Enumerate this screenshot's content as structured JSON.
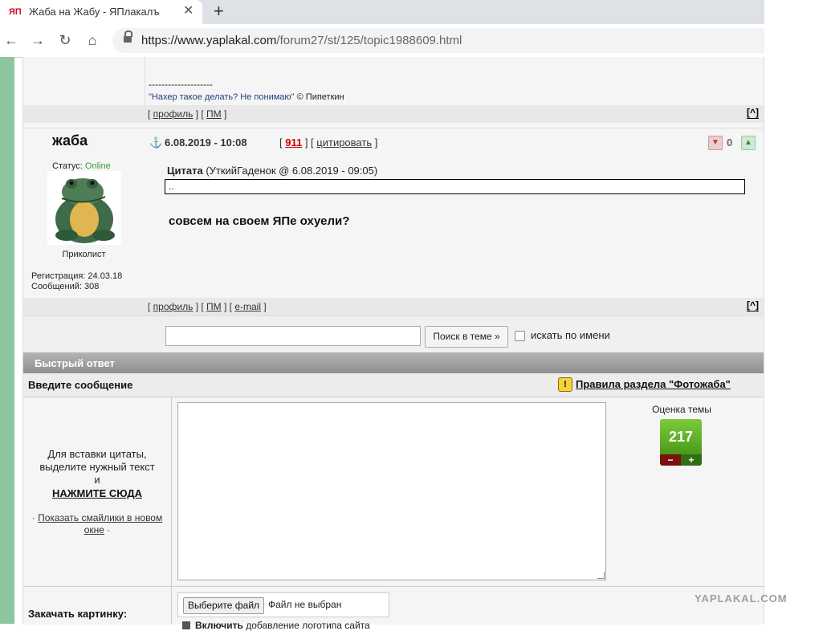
{
  "browser": {
    "tab_title": "Жаба на Жабу - ЯПлакалъ",
    "favicon_text": "ЯП",
    "url_host": "https://www.yaplakal.com",
    "url_path": "/forum27/st/125/topic1988609.html"
  },
  "prev_post": {
    "sig_dashes": "--------------------",
    "sig_quote": "\"Нахер такое делать? Не понимаю\"",
    "sig_author": "© Пипеткин",
    "links": {
      "profile": "профиль",
      "pm": "ПМ"
    },
    "to_top": "[^]"
  },
  "post": {
    "nick": "жаба",
    "date": "6.08.2019 - 10:08",
    "number": "911",
    "quote_link": "цитировать",
    "votes": "0",
    "status_label": "Статус:",
    "status_value": "Online",
    "rank": "Приколист",
    "reg": "Регистрация: 24.03.18",
    "messages": "Сообщений: 308",
    "quote_title": "Цитата",
    "quote_meta": "(УткийГаденок @ 6.08.2019 - 09:05)",
    "quote_text": "..",
    "text": "совсем на своем ЯПе охуели?",
    "links": {
      "profile": "профиль",
      "pm": "ПМ",
      "email": "e-mail"
    },
    "to_top": "[^]"
  },
  "search": {
    "button": "Поиск в теме »",
    "by_name": "искать по имени"
  },
  "quick_reply": {
    "header": "Быстрый ответ",
    "enter_label": "Введите сообщение",
    "rules_link": "Правила раздела \"Фотожаба\"",
    "hint_line1": "Для вставки цитаты,",
    "hint_line2": "выделите нужный текст",
    "hint_line3": "и",
    "hint_click": "НАЖМИТЕ СЮДА",
    "smiles_link": "Показать смайлики в новом окне",
    "rating_label": "Оценка темы",
    "rating_value": "217",
    "upload_label": "Закачать картинку:",
    "file_button": "Выберите файл",
    "file_status": "Файл не выбран",
    "include_bold": "Включить",
    "include_rest": "добавление логотипа сайта"
  },
  "watermark": "YAPLAKAL.COM",
  "colors": {
    "online": "#3a9a3a",
    "post_number": "#cc0000",
    "rating": "#5aab24",
    "side_bar": "#8dc59f"
  }
}
